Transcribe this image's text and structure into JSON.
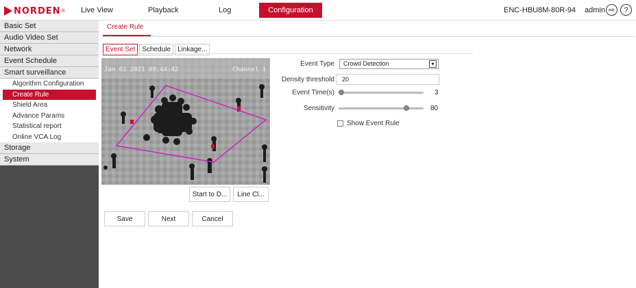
{
  "header": {
    "logo_text": "NORDEN",
    "logo_mark": "®",
    "nav": [
      "Live View",
      "Playback",
      "Log"
    ],
    "nav_active": "Configuration",
    "device_name": "ENC-HBU8M-80R-94",
    "user": "admin",
    "icons": [
      "logout-icon",
      "help-icon"
    ],
    "logout_glyph": "⇨",
    "help_glyph": "?"
  },
  "sidebar": {
    "groups_top": [
      "Basic Set",
      "Audio Video Set",
      "Network",
      "Event Schedule",
      "Smart surveillance"
    ],
    "sub_items": [
      {
        "label": "Algorithm Configuration",
        "active": false
      },
      {
        "label": "Create Rule",
        "active": true
      },
      {
        "label": "Shield Area",
        "active": false
      },
      {
        "label": "Advance Params",
        "active": false
      },
      {
        "label": "Statistical report",
        "active": false
      },
      {
        "label": "Online VCA Log",
        "active": false
      }
    ],
    "groups_bottom": [
      "Storage",
      "System"
    ]
  },
  "page": {
    "tab": "Create Rule",
    "subtabs": [
      {
        "label": "Event Set",
        "active": true
      },
      {
        "label": "Schedule",
        "active": false
      },
      {
        "label": "Linkage...",
        "active": false
      }
    ]
  },
  "video": {
    "timestamp": "Jan 01 2021 09:44:42",
    "channel": "Channel 1"
  },
  "video_buttons": {
    "start_label": "Start to D...",
    "line_label": "Line Cl..."
  },
  "form": {
    "event_type_label": "Event Type",
    "event_type_value": "Crowd Detection",
    "density_label": "Density threshold",
    "density_value": "20",
    "event_time_label": "Event Time(s)",
    "event_time_value": 3,
    "sensitivity_label": "Sensitivity",
    "sensitivity_value": 80,
    "show_rule_label": "Show Event Rule",
    "show_rule_checked": false
  },
  "actions": {
    "save": "Save",
    "next": "Next",
    "cancel": "Cancel"
  },
  "colors": {
    "accent": "#c8102e",
    "sidebar_bg": "#4b4b4b",
    "rule_polygon": "#d020c8"
  }
}
